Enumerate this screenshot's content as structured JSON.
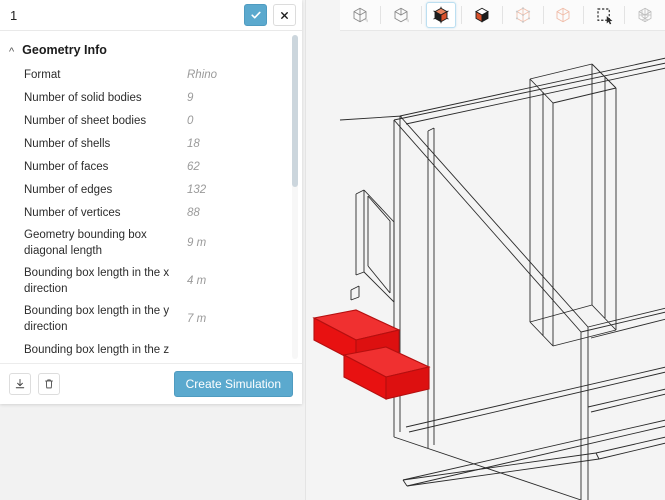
{
  "panel": {
    "title": "1",
    "confirm_icon": "check-icon",
    "close_icon": "close-icon",
    "section": {
      "title": "Geometry Info",
      "chevron_icon": "chevron-up-icon",
      "properties": [
        {
          "label": "Format",
          "value": "Rhino"
        },
        {
          "label": "Number of solid bodies",
          "value": "9"
        },
        {
          "label": "Number of sheet bodies",
          "value": "0"
        },
        {
          "label": "Number of shells",
          "value": "18"
        },
        {
          "label": "Number of faces",
          "value": "62"
        },
        {
          "label": "Number of edges",
          "value": "132"
        },
        {
          "label": "Number of vertices",
          "value": "88"
        },
        {
          "label": "Geometry bounding box diagonal length",
          "value": "9 m"
        },
        {
          "label": "Bounding box length in the x direction",
          "value": "4 m"
        },
        {
          "label": "Bounding box length in the y direction",
          "value": "7 m"
        },
        {
          "label": "Bounding box length in the z",
          "value": ""
        }
      ]
    },
    "footer": {
      "download_icon": "download-icon",
      "delete_icon": "trash-icon",
      "create_simulation_label": "Create Simulation"
    }
  },
  "viewport": {
    "toolbar": [
      {
        "name": "view-wireframe-icon",
        "active": false
      },
      {
        "name": "view-hidden-line-icon",
        "active": false
      },
      {
        "name": "view-shaded-solid-icon",
        "active": true
      },
      {
        "name": "view-shaded-flat-icon",
        "active": false
      },
      {
        "name": "view-points-icon",
        "active": false
      },
      {
        "name": "view-transparent-icon",
        "active": false
      },
      {
        "name": "box-select-icon",
        "active": false
      },
      {
        "name": "mesh-view-icon",
        "active": false
      }
    ],
    "colors": {
      "selection_red": "#ee1b1b",
      "accent_blue": "#5ba9ce",
      "wireframe_line": "#2b2b2b",
      "background": "#f4f4f4"
    }
  }
}
